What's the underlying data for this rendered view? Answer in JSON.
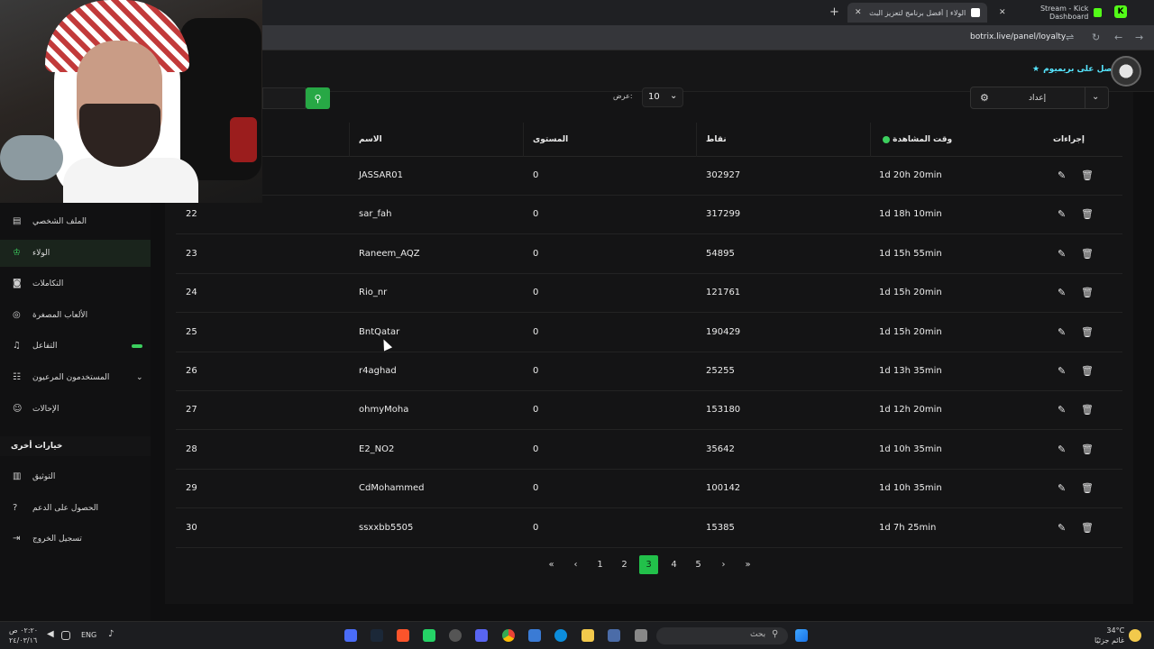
{
  "browser": {
    "tabs": [
      {
        "title": "Stream - Kick Dashboard",
        "active": false
      },
      {
        "title": "الولاء | أفضل برنامج لتعزيز البث ا",
        "active": true
      }
    ],
    "url": "botrix.live/panel/loyalty",
    "new_tab": "+",
    "close": "✕"
  },
  "header": {
    "premium_label": "احصل على بريميوم"
  },
  "sidebar": {
    "items": [
      {
        "label": "الملف الشخصي",
        "icon": "id-card-icon"
      },
      {
        "label": "الولاء",
        "icon": "trophy-icon"
      },
      {
        "label": "التكاملات",
        "icon": "discord-icon"
      },
      {
        "label": "الألعاب المصغرة",
        "icon": "gamepad-icon"
      },
      {
        "label": "التفاعل",
        "icon": "music-icon"
      },
      {
        "label": "المستخدمون المرعيون",
        "icon": "users-cog-icon"
      },
      {
        "label": "الإحالات",
        "icon": "users-icon"
      }
    ],
    "other_heading": "خيارات أخرى",
    "other_items": [
      {
        "label": "التوثيق",
        "icon": "book-icon"
      },
      {
        "label": "الحصول على الدعم",
        "icon": "question-icon"
      },
      {
        "label": "تسجيل الخروج",
        "icon": "logout-icon"
      }
    ]
  },
  "toolbar": {
    "settings_label": "إعداد",
    "show_label": "عرض:",
    "show_value": "10"
  },
  "table": {
    "headers": {
      "actions": "إجراءات",
      "watch_time": "وقت المشاهدة",
      "points": "نقاط",
      "level": "المستوى",
      "name": "الاسم"
    },
    "rows": [
      {
        "rank": "",
        "name": "JASSAR01",
        "level": "0",
        "points": "302927",
        "watch": "1d 20h 20min"
      },
      {
        "rank": "22",
        "name": "sar_fah",
        "level": "0",
        "points": "317299",
        "watch": "1d 18h 10min"
      },
      {
        "rank": "23",
        "name": "Raneem_AQZ",
        "level": "0",
        "points": "54895",
        "watch": "1d 15h 55min"
      },
      {
        "rank": "24",
        "name": "Rio_nr",
        "level": "0",
        "points": "121761",
        "watch": "1d 15h 20min"
      },
      {
        "rank": "25",
        "name": "BntQatar",
        "level": "0",
        "points": "190429",
        "watch": "1d 15h 20min"
      },
      {
        "rank": "26",
        "name": "r4aghad",
        "level": "0",
        "points": "25255",
        "watch": "1d 13h 35min"
      },
      {
        "rank": "27",
        "name": "ohmyMoha",
        "level": "0",
        "points": "153180",
        "watch": "1d 12h 20min"
      },
      {
        "rank": "28",
        "name": "E2_NO2",
        "level": "0",
        "points": "35642",
        "watch": "1d 10h 35min"
      },
      {
        "rank": "29",
        "name": "CdMohammed",
        "level": "0",
        "points": "100142",
        "watch": "1d 10h 35min"
      },
      {
        "rank": "30",
        "name": "ssxxbb5505",
        "level": "0",
        "points": "15385",
        "watch": "1d 7h 25min"
      }
    ]
  },
  "pagination": {
    "first": "«",
    "prev": "‹",
    "pages": [
      "1",
      "2",
      "3",
      "4",
      "5"
    ],
    "active": "3",
    "next": "›",
    "last": "»"
  },
  "taskbar": {
    "search_label": "بحث",
    "lang": "ENG",
    "time": "٠٢:٢٠ ص",
    "date": "٢٤/٠٣/١٦",
    "temp": "34°C",
    "weather": "غائم جزئيًا"
  },
  "colors": {
    "accent": "#22c04a",
    "premium": "#56e6ff"
  }
}
